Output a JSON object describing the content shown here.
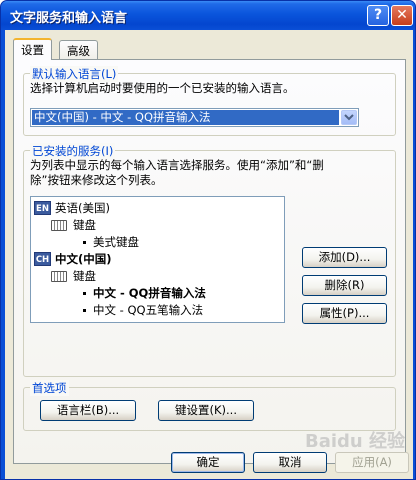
{
  "window": {
    "title": "文字服务和输入语言"
  },
  "title_buttons": {
    "help": "?",
    "close": "✕"
  },
  "tabs": [
    {
      "label": "设置"
    },
    {
      "label": "高级"
    }
  ],
  "default_language": {
    "group_title": "默认输入语言(L)",
    "description": "选择计算机启动时要使用的一个已安装的输入语言。",
    "selected": "中文(中国) - 中文 - QQ拼音输入法"
  },
  "installed_services": {
    "group_title": "已安装的服务(I)",
    "description_line1": "为列表中显示的每个输入语言选择服务。使用“添加”和“删",
    "description_line2": "除”按钮来修改这个列表。",
    "tree": {
      "lang1_badge": "EN",
      "lang1": "英语(美国)",
      "lang1_keyboard": "键盘",
      "lang1_item1": "美式键盘",
      "lang2_badge": "CH",
      "lang2": "中文(中国)",
      "lang2_keyboard": "键盘",
      "lang2_item1": "中文 - QQ拼音输入法",
      "lang2_item2": "中文 - QQ五笔输入法"
    },
    "add_button": "添加(D)...",
    "remove_button": "删除(R)",
    "properties_button": "属性(P)..."
  },
  "preferences": {
    "group_title": "首选项",
    "language_bar_button": "语言栏(B)...",
    "key_settings_button": "键设置(K)..."
  },
  "footer": {
    "ok_button": "确定",
    "cancel_button": "取消",
    "apply_button": "应用(A)"
  },
  "watermark": "Baidu 经验"
}
